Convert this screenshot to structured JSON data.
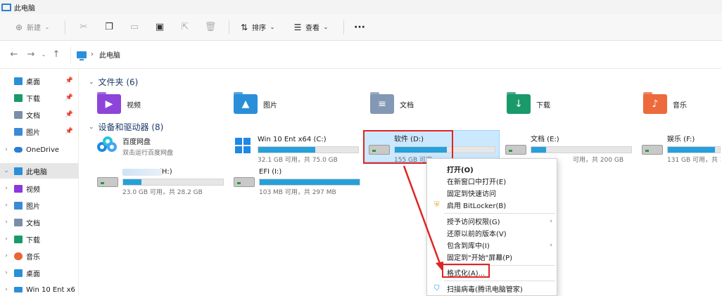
{
  "window": {
    "title": "此电脑"
  },
  "toolbar": {
    "new_label": "新建",
    "sort_label": "排序",
    "view_label": "查看",
    "more_label": "···"
  },
  "address": {
    "path_root": "›",
    "path": "此电脑"
  },
  "sidebar": {
    "quick": [
      {
        "label": "桌面",
        "icon": "desktop-icon",
        "color": "#2a8fd8"
      },
      {
        "label": "下载",
        "icon": "download-icon",
        "color": "#1a9a6a"
      },
      {
        "label": "文档",
        "icon": "document-icon",
        "color": "#7a8ea8"
      },
      {
        "label": "图片",
        "icon": "picture-icon",
        "color": "#3a8ad8"
      }
    ],
    "onedrive": "OneDrive",
    "thispc": "此电脑",
    "pc_children": [
      {
        "label": "视频",
        "icon": "video-icon",
        "color": "#8a3ad8"
      },
      {
        "label": "图片",
        "icon": "picture-icon",
        "color": "#3a8ad8"
      },
      {
        "label": "文档",
        "icon": "document-icon",
        "color": "#7a8ea8"
      },
      {
        "label": "下载",
        "icon": "download-icon",
        "color": "#1a9a6a"
      },
      {
        "label": "音乐",
        "icon": "music-icon",
        "color": "#e8663a"
      },
      {
        "label": "桌面",
        "icon": "desktop-icon",
        "color": "#2a8fd8"
      },
      {
        "label": "Win 10 Ent x6",
        "icon": "drive-icon",
        "color": "#2a8fd8"
      }
    ]
  },
  "folders_group": {
    "title": "文件夹 (6)",
    "items": [
      {
        "label": "视频",
        "icon": "video-folder-icon",
        "color": "#8e44d8"
      },
      {
        "label": "图片",
        "icon": "picture-folder-icon",
        "color": "#2a8fd8"
      },
      {
        "label": "文档",
        "icon": "document-folder-icon",
        "color": "#8298b4"
      },
      {
        "label": "下载",
        "icon": "download-folder-icon",
        "color": "#1a9a6a"
      },
      {
        "label": "音乐",
        "icon": "music-folder-icon",
        "color": "#ec6a3c"
      }
    ]
  },
  "drives_group": {
    "title": "设备和驱动器 (8)",
    "baidu": {
      "name": "百度网盘",
      "sub": "双击运行百度网盘"
    },
    "drives": [
      {
        "name": "Win 10 Ent x64 (C:)",
        "free": "32.1 GB 可用，共 75.0 GB",
        "used": 0.57
      },
      {
        "name": "软件 (D:)",
        "free": "155 GB 可用",
        "used": 0.52
      },
      {
        "name": "文档 (E:)",
        "free": "可用，共 200 GB",
        "used": 0.15
      },
      {
        "name": "娱乐 (F:)",
        "free": "131 GB 可用，共 2",
        "used": 0.9
      },
      {
        "name": "(H:)",
        "free": "23.0 GB 可用，共 28.2 GB",
        "used": 0.18
      },
      {
        "name": "EFI (I:)",
        "free": "103 MB 可用，共 297 MB",
        "used": 1.0
      }
    ]
  },
  "context_menu": {
    "open": "打开(O)",
    "open_new_window": "在新窗口中打开(E)",
    "pin_quick": "固定到快速访问",
    "bitlocker": "启用 BitLocker(B)",
    "grant_access": "授予访问权限(G)",
    "restore": "还原以前的版本(V)",
    "include_library": "包含到库中(I)",
    "pin_start": "固定到\"开始\"屏幕(P)",
    "format": "格式化(A)...",
    "scan": "扫描病毒(腾讯电脑管家)"
  }
}
